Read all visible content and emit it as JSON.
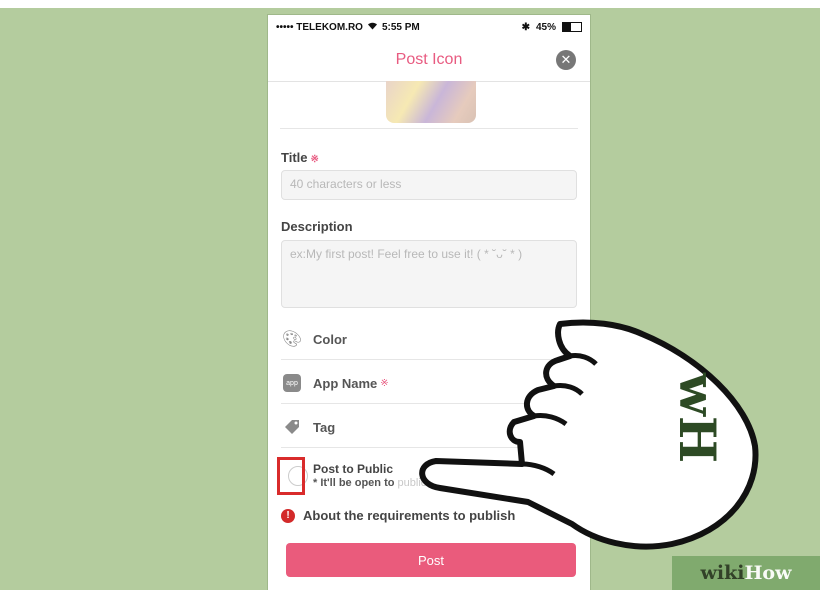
{
  "status_bar": {
    "carrier": "••••• TELEKOM.RO",
    "wifi_icon": "wifi-icon",
    "time": "5:55 PM",
    "bluetooth_icon": "bluetooth-icon",
    "battery": "45%"
  },
  "navbar": {
    "title": "Post Icon",
    "close_icon": "close-icon"
  },
  "form": {
    "title_label": "Title",
    "required_mark": "※",
    "title_placeholder": "40 characters or less",
    "description_label": "Description",
    "description_placeholder": "ex:My first post! Feel free to use it! ( * ˘ᴗ˘ * )",
    "options": [
      {
        "label": "Color",
        "icon": "palette-icon",
        "required": false
      },
      {
        "label": "App Name",
        "icon": "app-icon",
        "required": true
      },
      {
        "label": "Tag",
        "icon": "tag-icon",
        "required": false
      }
    ],
    "post_public_title": "Post to Public",
    "post_public_note": "* It'll be open to",
    "post_public_note_faded": "public after the review",
    "requirements_link": "About the requirements to publish",
    "post_button": "Post"
  },
  "watermark": {
    "wiki": "wiki",
    "how": "How",
    "badge": "wH"
  },
  "colors": {
    "accent": "#ea5b7c",
    "background": "#b4cc9e",
    "highlight": "#d92b2b"
  }
}
